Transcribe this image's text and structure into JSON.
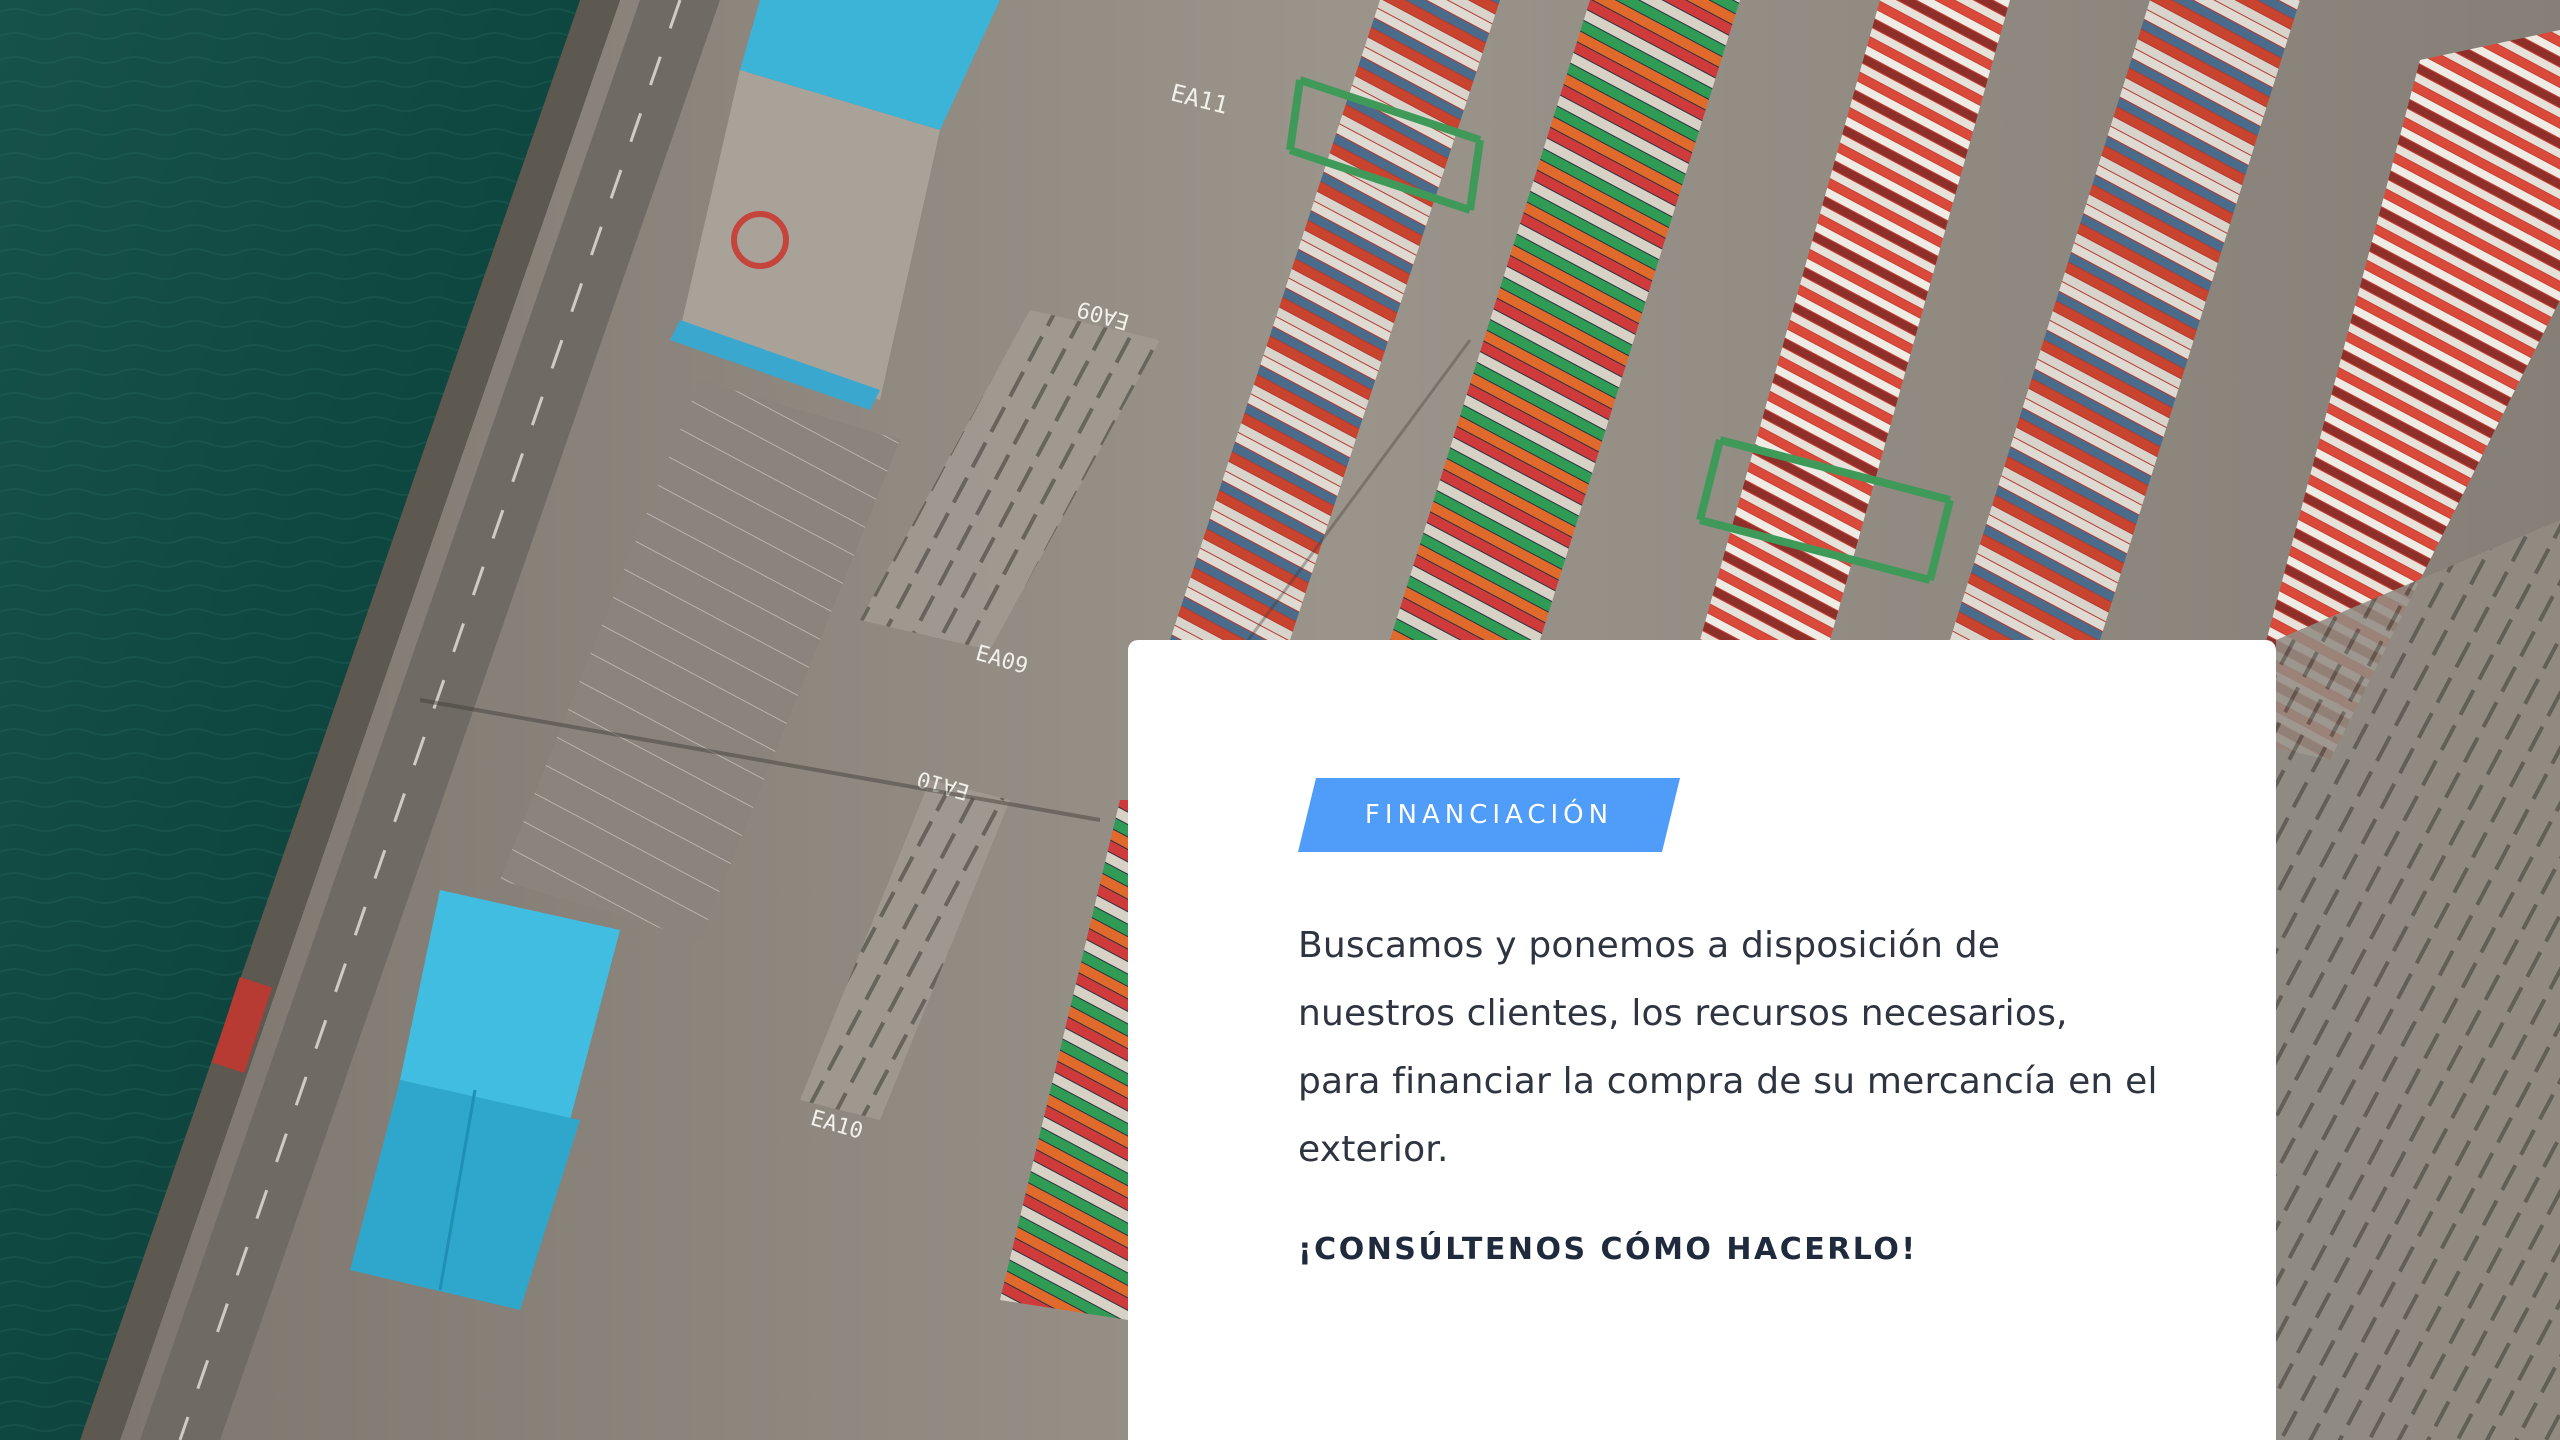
{
  "card": {
    "tag_label": "FINANCIACIÓN",
    "tag_color": "#4f9cf9",
    "body_text": "Buscamos y ponemos a disposición de nuestros clientes, los recursos necesarios, para financiar la compra de su mercancía en el exterior.",
    "cta_text": "¡CONSÚLTENOS CÓMO HACERLO!"
  },
  "background": {
    "subject": "aerial-port-container-terminal",
    "labels": [
      "EA11",
      "EA09",
      "EA09",
      "EA10",
      "EA10"
    ],
    "colors": {
      "water": "#0e4a43",
      "quay": "#8d877f",
      "warehouse_roof": "#3bb4d8"
    }
  }
}
